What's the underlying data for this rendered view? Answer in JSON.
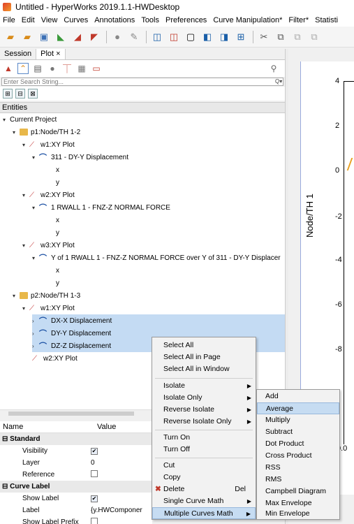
{
  "window": {
    "title": "Untitled - HyperWorks 2019.1.1-HWDesktop"
  },
  "menu": [
    "File",
    "Edit",
    "View",
    "Curves",
    "Annotations",
    "Tools",
    "Preferences",
    "Curve Manipulation*",
    "Filter*",
    "Statisti"
  ],
  "tabs": {
    "session": "Session",
    "plot": "Plot ×"
  },
  "search": {
    "placeholder": "Enter Search String..."
  },
  "entities": {
    "header": "Entities"
  },
  "tree": {
    "current_project": "Current Project",
    "p1": "p1:Node/TH 1-2",
    "p1_w1": "w1:XY Plot",
    "p1_w1_c1": "311 - DY-Y Displacement",
    "p1_w2": "w2:XY Plot",
    "p1_w2_c1": "1 RWALL 1 - FNZ-Z NORMAL FORCE",
    "p1_w3": "w3:XY Plot",
    "p1_w3_c1": "Y of 1 RWALL 1 - FNZ-Z NORMAL FORCE over Y of 311 - DY-Y Displacer",
    "x": "x",
    "y": "y",
    "p2": "p2:Node/TH 1-3",
    "p2_w1": "w1:XY Plot",
    "p2_w1_c1": "DX-X Displacement",
    "p2_w1_c2": "DY-Y Displacement",
    "p2_w1_c3": "DZ-Z Displacement",
    "p2_w2": "w2:XY Plot"
  },
  "props": {
    "col_name": "Name",
    "col_value": "Value",
    "standard": "Standard",
    "visibility": "Visibility",
    "layer": "Layer",
    "layer_val": "0",
    "reference": "Reference",
    "curve_label": "Curve Label",
    "show_label": "Show Label",
    "label": "Label",
    "label_val": "{y.HWComponer",
    "show_label_prefix": "Show Label Prefix"
  },
  "plot": {
    "ylabel": "Node/TH 1",
    "ticks": [
      "4",
      "2",
      "0",
      "-2",
      "-4",
      "-6",
      "-8",
      "0.0"
    ]
  },
  "context_menu": {
    "select_all": "Select All",
    "select_all_page": "Select All in Page",
    "select_all_window": "Select All in Window",
    "isolate": "Isolate",
    "isolate_only": "Isolate Only",
    "reverse_isolate": "Reverse Isolate",
    "reverse_isolate_only": "Reverse Isolate Only",
    "turn_on": "Turn On",
    "turn_off": "Turn Off",
    "cut": "Cut",
    "copy": "Copy",
    "delete": "Delete",
    "delete_shortcut": "Del",
    "single_curve_math": "Single Curve Math",
    "multiple_curves_math": "Multiple Curves Math"
  },
  "submenu": {
    "add": "Add",
    "average": "Average",
    "multiply": "Multiply",
    "subtract": "Subtract",
    "dot_product": "Dot Product",
    "cross_product": "Cross Product",
    "rss": "RSS",
    "rms": "RMS",
    "campbell": "Campbell Diagram",
    "max_env": "Max Envelope",
    "min_env": "Min Envelope"
  }
}
